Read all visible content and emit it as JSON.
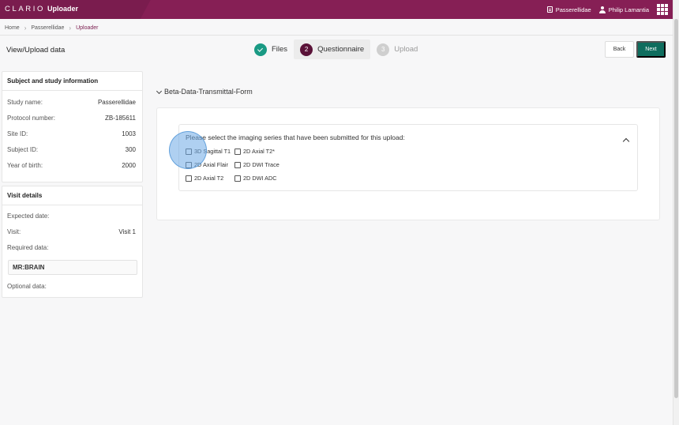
{
  "header": {
    "logo": "CLARIO",
    "app_title": "Uploader",
    "study_label": "Passerellidae",
    "user_name": "Philip Lamantia",
    "colors": {
      "brand": "#7a1c4e",
      "accent": "#0f6d5e",
      "done": "#1a9a84"
    }
  },
  "breadcrumb": [
    "Home",
    "Passerellidae",
    "Uploader"
  ],
  "page_title": "View/Upload data",
  "stepper": [
    {
      "label": "Files",
      "number": "",
      "state": "done"
    },
    {
      "label": "Questionnaire",
      "number": "2",
      "state": "current"
    },
    {
      "label": "Upload",
      "number": "3",
      "state": "todo"
    }
  ],
  "actions": {
    "back": "Back",
    "next": "Next"
  },
  "subject_card": {
    "title": "Subject and study information",
    "rows": [
      {
        "label": "Study name:",
        "value": "Passerellidae"
      },
      {
        "label": "Protocol number:",
        "value": "ZB-185611"
      },
      {
        "label": "Site ID:",
        "value": "1003"
      },
      {
        "label": "Subject ID:",
        "value": "300"
      },
      {
        "label": "Year of birth:",
        "value": "2000"
      }
    ]
  },
  "visit_card": {
    "title": "Visit details",
    "expected_label": "Expected date:",
    "expected_value": "",
    "visit_label": "Visit:",
    "visit_value": "Visit 1",
    "required_label": "Required data:",
    "required_value": "MR:BRAIN",
    "optional_label": "Optional data:"
  },
  "form": {
    "name": "Beta-Data-Transmittal-Form",
    "question": "Please select the imaging series that have been submitted for this upload:",
    "options": [
      {
        "label": "3D Sagittal T1",
        "checked": false
      },
      {
        "label": "2D Axial T2*",
        "checked": false
      },
      {
        "label": "2D Axial Flair",
        "checked": false
      },
      {
        "label": "2D DWI Trace",
        "checked": false
      },
      {
        "label": "2D Axial T2",
        "checked": false
      },
      {
        "label": "2D DWI ADC",
        "checked": false
      }
    ]
  }
}
